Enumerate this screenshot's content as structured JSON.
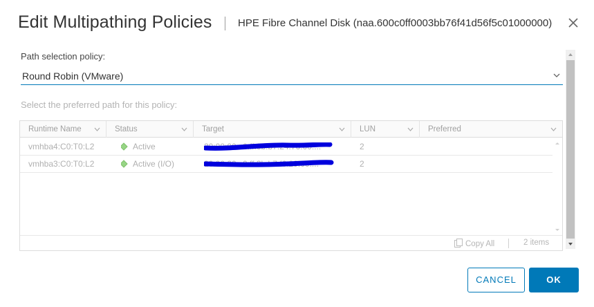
{
  "dialog": {
    "title": "Edit Multipathing Policies",
    "subtitle": "HPE Fibre Channel Disk (naa.600c0ff0003bb76f41d56f5c01000000)"
  },
  "policy": {
    "label": "Path selection policy:",
    "selected": "Round Robin (VMware)"
  },
  "preferred": {
    "label": "Select the preferred path for this policy:"
  },
  "grid": {
    "columns": [
      {
        "label": "Runtime Name"
      },
      {
        "label": "Status"
      },
      {
        "label": "Target"
      },
      {
        "label": "LUN"
      },
      {
        "label": "Preferred"
      }
    ],
    "rows": [
      {
        "runtime": "vmhba4:C0:T0:L2",
        "status": "Active",
        "target": "20:00:00:c0:ff:3b:b7:24:76:00:...",
        "lun": "2",
        "preferred": ""
      },
      {
        "runtime": "vmhba3:C0:T0:L2",
        "status": "Active (I/O)",
        "target": "20:00:00:c0:ff:3b:b7:f6:29:00:...",
        "lun": "2",
        "preferred": ""
      }
    ],
    "footer": {
      "copy_label": "Copy All",
      "count_label": "2 items"
    }
  },
  "buttons": {
    "cancel": "CANCEL",
    "ok": "OK"
  },
  "colors": {
    "accent": "#0079b8",
    "status_active": "#97d585",
    "redaction": "#0000dd"
  }
}
